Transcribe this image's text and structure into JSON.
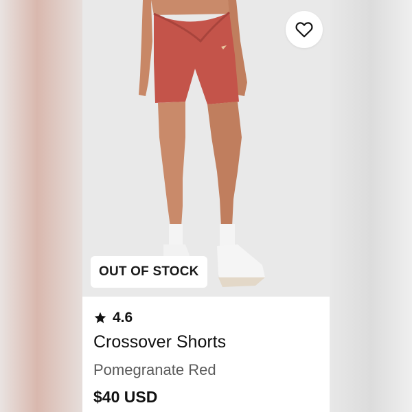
{
  "product": {
    "badge": "OUT OF STOCK",
    "rating": "4.6",
    "name": "Crossover Shorts",
    "color": "Pomegranate Red",
    "price": "$40 USD"
  },
  "icons": {
    "wishlist": "heart-outline-icon",
    "rating": "star-icon"
  },
  "colors": {
    "shorts": "#c4544a",
    "skin": "#c98a6a",
    "background": "#e9e9e9"
  }
}
